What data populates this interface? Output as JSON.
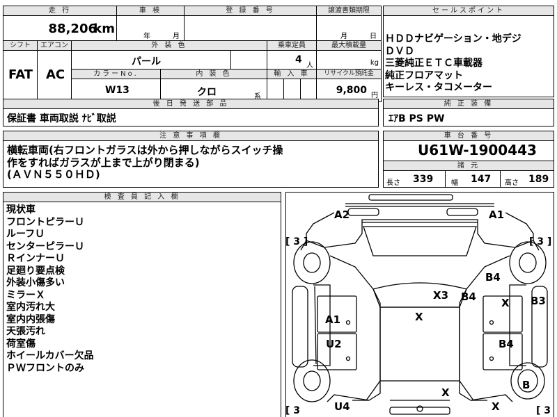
{
  "top_left_value": "88,206",
  "km_unit": "km",
  "headers": {
    "mileage": "走 行",
    "inspection": "車 検",
    "registration": "登 録 番 号",
    "transfer_deadline": "譲渡書類期限",
    "sales_point": "セールスポイント",
    "shift": "シフト",
    "aircon": "エアコン",
    "exterior_color": "外 装 色",
    "capacity": "乗車定員",
    "max_load": "最大積載量",
    "color_no": "カラーNo.",
    "interior_color": "内 装 色",
    "import": "輸 入 車",
    "recycle": "リサイクル預託金",
    "accessories_after": "後 日 発 送 部 品",
    "genuine_equipment": "純 正 装 備",
    "caution": "注 意 事 項 欄",
    "chassis_no": "車 台 番 号",
    "dimensions": "諸 元",
    "inspector_notes": "検 査 員 記 入 欄"
  },
  "inspection_units": {
    "year": "年",
    "month": "月"
  },
  "transfer_units": {
    "month": "月",
    "day": "日"
  },
  "shift_value": "FAT",
  "aircon_value": "AC",
  "exterior_color_value": "パール",
  "capacity_value": "4",
  "capacity_unit": "人",
  "max_load_unit": "kg",
  "color_no_value": "W13",
  "interior_color_value": "クロ",
  "interior_suffix": "系",
  "recycle_value": "9,800",
  "recycle_unit": "円",
  "sales_points": [
    "ＨＤＤナビゲーション・地デジ",
    "ＤＶＤ",
    "三菱純正ＥＴＣ車載器",
    "純正フロアマット",
    "キーレス・タコメーター"
  ],
  "accessories_after_value": "保証書 車両取説 ﾅﾋﾞ取説",
  "genuine_equipment_value": "ｴｱB PS PW",
  "caution_lines": [
    "横転車両(右フロントガラスは外から押しながらスイッチ操",
    "作をすればガラスが上まで上がり閉まる)",
    "(ＡＶＮ５５０ＨＤ)"
  ],
  "chassis_value": "U61W-1900443",
  "dims": {
    "length_label": "長さ",
    "length_value": "339",
    "width_label": "幅",
    "width_value": "147",
    "height_label": "高さ",
    "height_value": "189"
  },
  "inspector_notes": [
    "現状車",
    "フロントピラーＵ",
    "ルーフＵ",
    "センターピラーＵ",
    "ＲインナーＵ",
    "足廻り要点検",
    "外装小傷多い",
    "ミラーＸ",
    "室内汚れ大",
    "室内内張傷",
    "天張汚れ",
    "荷室傷",
    "ホイールカバー欠品",
    "ＰＷフロントのみ"
  ],
  "diagram_marks": {
    "a2": "A2",
    "a1_top": "A1",
    "b4_1": "B4",
    "x3": "X3",
    "b4_2": "B4",
    "x_right": "X",
    "b3": "B3",
    "a1_left": "A1",
    "x_center": "X",
    "u2": "U2",
    "b4_3": "B4",
    "b": "B",
    "x_bottom_center": "X",
    "u4": "U4",
    "x_bottom_right": "X",
    "bracket_tl": "[ 3 ]",
    "bracket_tr": "[ 3 ]",
    "bracket_bl": "[ 3",
    "bracket_br": "[ 3"
  }
}
